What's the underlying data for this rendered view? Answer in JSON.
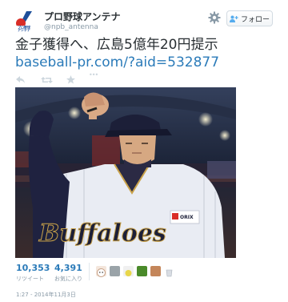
{
  "account": {
    "name": "プロ野球アンテナ",
    "handle": "@npb_antenna",
    "logo_text": "プロ野球アンテナ"
  },
  "header": {
    "follow_label": "フォロー",
    "settings_icon": "gear-icon",
    "follow_icon": "user-plus-icon"
  },
  "tweet": {
    "text": "金子獲得へ、広島5億年20円提示 ",
    "link": "baseball-pr.com/?aid=532877"
  },
  "actions": {
    "icons": [
      "reply-icon",
      "retweet-icon",
      "favorite-icon",
      "more-icon"
    ],
    "more_label": "•••"
  },
  "stats": {
    "retweets_count": "10,353",
    "retweets_label": "リツイート",
    "favorites_count": "4,391",
    "favorites_label": "お気に入り"
  },
  "photo": {
    "jersey_text": "Buffaloes",
    "sponsor_text": "ORIX"
  },
  "timestamp": "1:27 - 2014年11月3日",
  "colors": {
    "link": "#2b7bb9",
    "muted": "#8899a6",
    "text": "#292f33",
    "accent": "#55acee"
  }
}
